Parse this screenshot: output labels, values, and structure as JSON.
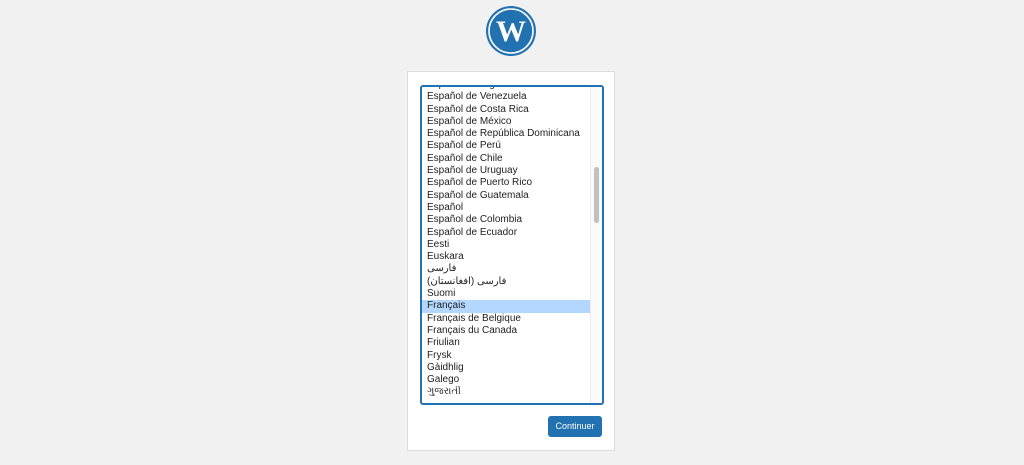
{
  "logo": {
    "icon": "wordpress-logo-icon",
    "color": "#2271b1"
  },
  "language_select": {
    "selected": "Français",
    "items": [
      "Español de Argentina",
      "Español de Venezuela",
      "Español de Costa Rica",
      "Español de México",
      "Español de República Dominicana",
      "Español de Perú",
      "Español de Chile",
      "Español de Uruguay",
      "Español de Puerto Rico",
      "Español de Guatemala",
      "Español",
      "Español de Colombia",
      "Español de Ecuador",
      "Eesti",
      "Euskara",
      "فارسی",
      "(فارسی (افغانستان",
      "Suomi",
      "Français",
      "Français de Belgique",
      "Français du Canada",
      "Friulian",
      "Frysk",
      "Gàidhlig",
      "Galego",
      "ગુજરાતી"
    ]
  },
  "continue_button": {
    "label": "Continuer"
  },
  "colors": {
    "accent": "#2271b1",
    "selection": "#b3d7ff",
    "background": "#f1f1f1"
  }
}
